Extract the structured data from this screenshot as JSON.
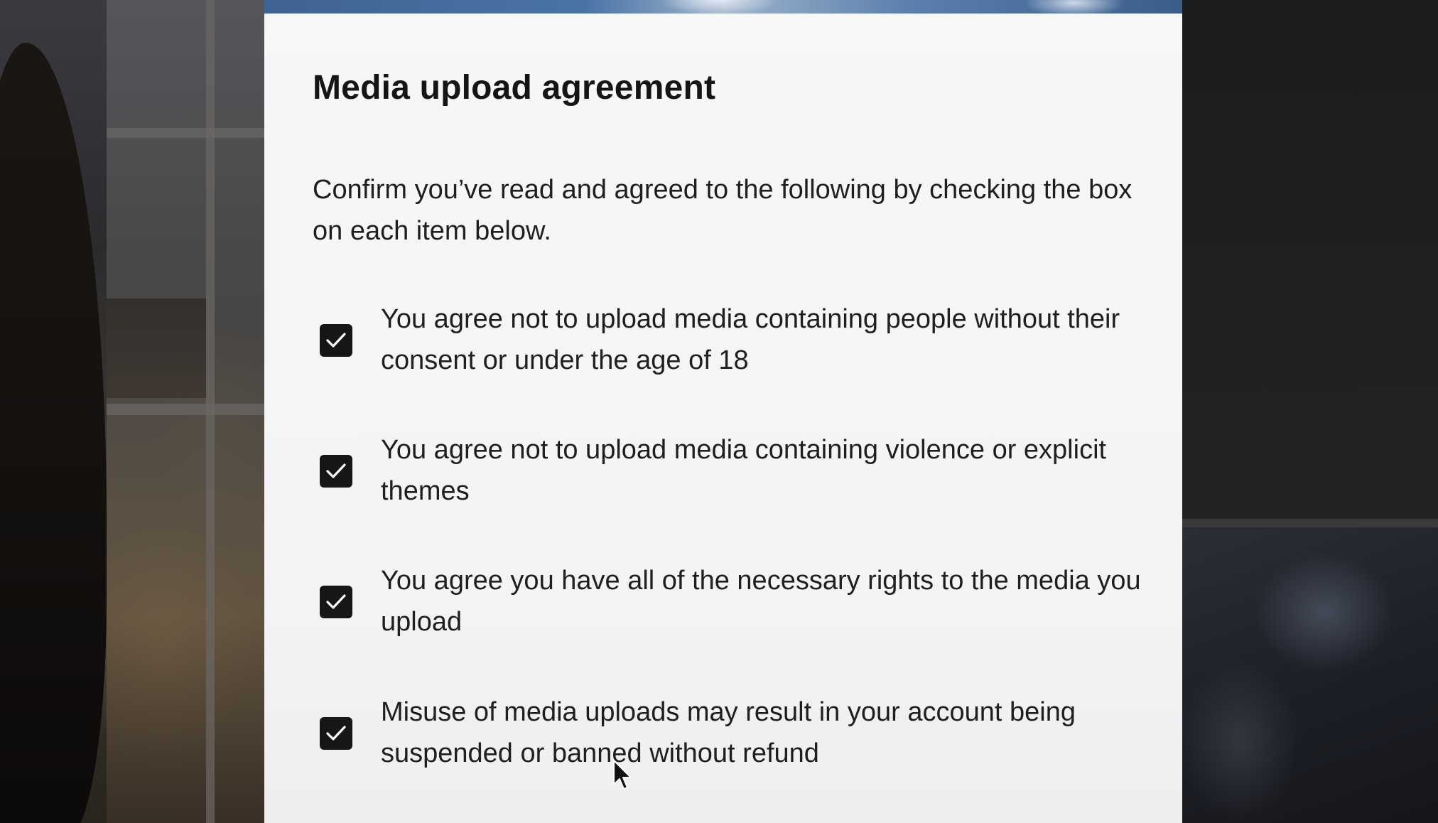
{
  "dialog": {
    "title": "Media upload agreement",
    "intro": "Confirm you’ve read and agreed to the following by checking the box on each item below."
  },
  "agreements": [
    {
      "checked": true,
      "text": "You agree not to upload media containing people without their consent or under the age of 18"
    },
    {
      "checked": true,
      "text": "You agree not to upload media containing violence or explicit themes"
    },
    {
      "checked": true,
      "text": "You agree you have all of the necessary rights to the media you upload"
    },
    {
      "checked": true,
      "text": "Misuse of media uploads may result in your account being suspended or banned without refund"
    }
  ],
  "colors": {
    "panel_background": "#f5f5f6",
    "checkbox_fill": "#161616",
    "text": "#1f1f1f"
  },
  "icons": {
    "checkbox_mark": "checkmark-icon",
    "pointer": "mouse-pointer-icon"
  }
}
